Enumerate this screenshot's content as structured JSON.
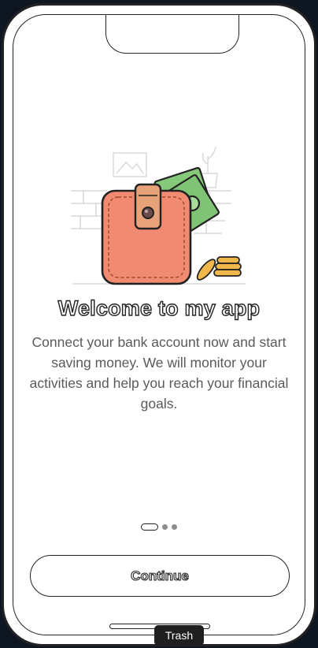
{
  "onboarding": {
    "title": "Welcome to my app",
    "description": "Connect your bank account now and start saving money. We will monitor your activities and help you reach your financial goals.",
    "pager": {
      "current_page": 1,
      "total_pages": 3
    },
    "continue_label": "Continue"
  },
  "tooltip": {
    "text": "Trash"
  },
  "colors": {
    "wallet": "#f08a70",
    "wallet_strap": "#e8a27a",
    "money": "#7fc475",
    "coins": "#f2b84b",
    "outline": "#222222",
    "body_text": "#5a5a5a"
  },
  "icons": {
    "illustration": "wallet-with-money-illustration"
  }
}
